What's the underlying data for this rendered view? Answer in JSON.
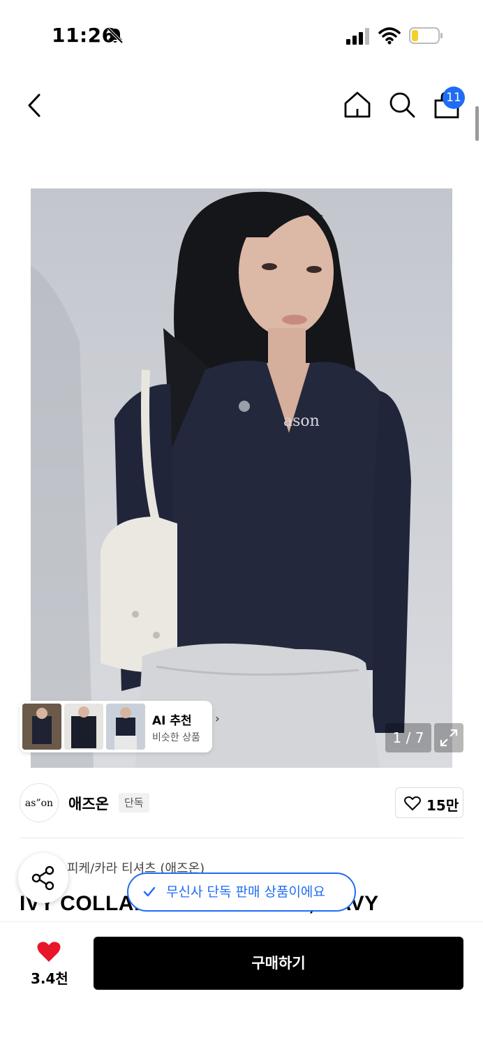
{
  "status_bar": {
    "time": "11:26"
  },
  "nav": {
    "cart_badge": "11"
  },
  "gallery": {
    "counter": "1 / 7",
    "ai_title": "AI 추천",
    "ai_subtitle": "비슷한 상품"
  },
  "brand": {
    "logo_text": "as”on",
    "name": "애즈온",
    "tag": "단독",
    "likes": "15만"
  },
  "product": {
    "category": "피케/카라 티셔츠 (애즈온)",
    "name": "IVY COLLAR LONG SLEEVE, NAVY",
    "exclusive_notice": "무신사 단독 판매 상품이에요"
  },
  "bottom_bar": {
    "wish_count": "3.4천",
    "buy_label": "구매하기"
  },
  "colors": {
    "accent_blue": "#1f6cf5",
    "heart_red": "#e8162b",
    "buy_black": "#000000"
  }
}
